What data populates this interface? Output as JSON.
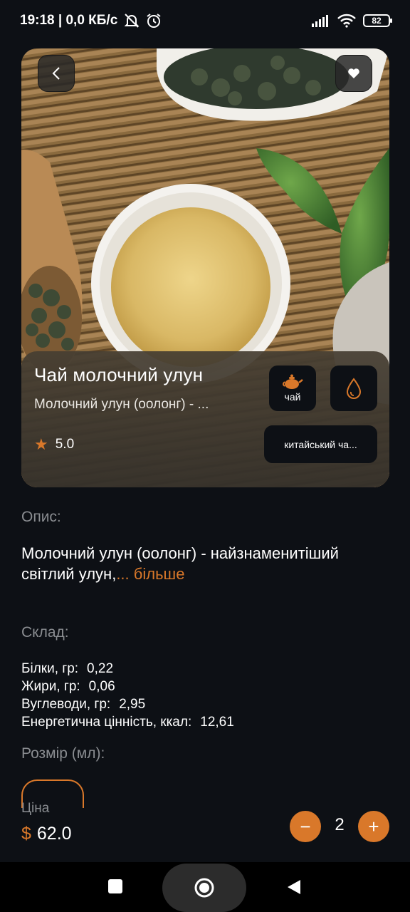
{
  "status_bar": {
    "time_info": "19:18 | 0,0 КБ/с",
    "battery": "82"
  },
  "product": {
    "title": "Чай молочний улун",
    "subtitle": "Молочний улун (оолонг) - ...",
    "rating": "5.0",
    "category_chip": "чай",
    "region_chip": "китайський ча...",
    "image_alt": "tea cup on bamboo mat"
  },
  "description": {
    "label": "Опис:",
    "text": "Молочний улун (оолонг) - найзнаменитіший світлий улун,",
    "more": "... більше"
  },
  "composition": {
    "label": "Склад:",
    "rows": [
      {
        "name": "Білки, гр:",
        "value": "0,22"
      },
      {
        "name": "Жири, гр:",
        "value": "0,06"
      },
      {
        "name": "Вуглеводи, гр:",
        "value": "2,95"
      },
      {
        "name": "Енергетична цінність, ккал:",
        "value": "12,61"
      }
    ]
  },
  "size": {
    "label": "Розмір (мл):"
  },
  "price": {
    "label": "Ціна",
    "currency": "$",
    "value": "62.0"
  },
  "quantity": {
    "value": "2",
    "minus": "−",
    "plus": "+"
  },
  "colors": {
    "accent": "#d9782a",
    "background": "#0d1015",
    "muted": "#8a8d91"
  },
  "icons": {
    "back": "chevron-left-icon",
    "favorite": "heart-icon",
    "teapot": "teapot-icon",
    "drop": "water-drop-icon",
    "star": "star-icon"
  }
}
